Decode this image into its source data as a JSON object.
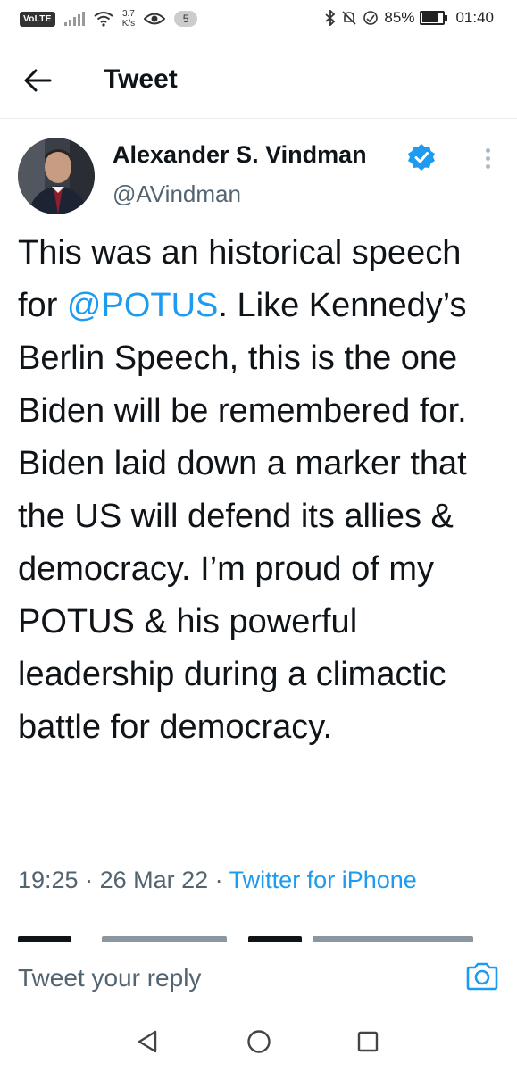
{
  "status_bar": {
    "carrier_badge": "VoLTE",
    "net_speed_value": "3.7",
    "net_speed_unit": "K/s",
    "notification_count": "5",
    "battery": "85%",
    "time": "01:40"
  },
  "header": {
    "title": "Tweet"
  },
  "tweet": {
    "author_name": "Alexander S. Vindman",
    "author_handle": "@AVindman",
    "text_before": "This was an historical speech for ",
    "mention": "@POTUS",
    "text_after": ". Like Kennedy’s Berlin Speech, this is the one Biden will be remembered for. Biden laid down a marker that the US will defend its allies & democracy. I’m proud of my POTUS & his powerful leadership during a climactic battle for democracy.",
    "time": "19:25",
    "date": "26 Mar 22",
    "source": "Twitter for iPhone",
    "separator": " · "
  },
  "reply": {
    "placeholder": "Tweet your reply"
  },
  "colors": {
    "accent": "#1d9bf0",
    "text": "#0f1419",
    "secondary": "#536471"
  },
  "icons": [
    "back-arrow-icon",
    "verified-badge-icon",
    "more-vertical-icon",
    "camera-icon",
    "nav-back-icon",
    "nav-home-icon",
    "nav-recents-icon"
  ]
}
